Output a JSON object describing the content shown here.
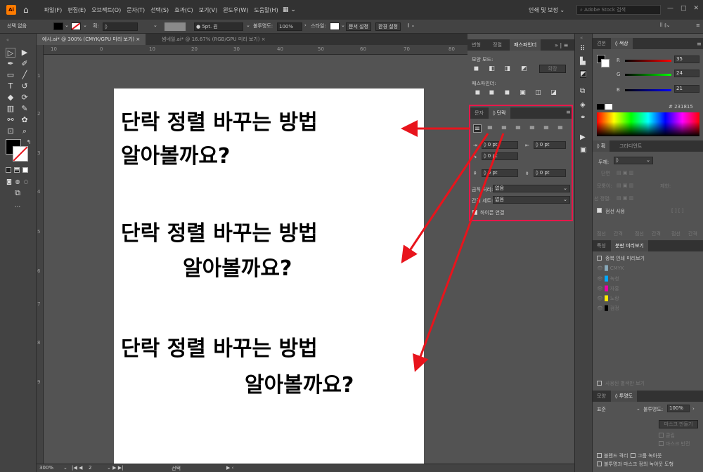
{
  "menubar": {
    "app_logo": "Ai",
    "home_icon": "home-icon",
    "items": [
      "파일(F)",
      "편집(E)",
      "오브젝트(O)",
      "문자(T)",
      "선택(S)",
      "효과(C)",
      "보기(V)",
      "윈도우(W)",
      "도움말(H)"
    ],
    "workspace": "인쇄 및 보정",
    "stock_search_placeholder": "Adobe Stock 검색"
  },
  "control_bar": {
    "selection": "선택 없음",
    "stroke_label": "획:",
    "brush": "5pt. 원",
    "opacity_label": "불투명도:",
    "opacity_value": "100%",
    "style_label": "스타일:",
    "doc_setup": "문서 설정",
    "preferences": "환경 설정"
  },
  "doc_tabs": [
    {
      "label": "예시.ai* @ 300% (CMYK/GPU 미리 보기)",
      "close": "×"
    },
    {
      "label": "썸네일.ai* @ 16.67% (RGB/GPU 미리 보기)",
      "close": "×"
    }
  ],
  "ruler_top": [
    "10",
    "0",
    "10",
    "20",
    "30",
    "40",
    "50",
    "60",
    "70",
    "80"
  ],
  "ruler_left": [
    "1",
    "2",
    "3",
    "4",
    "5",
    "6",
    "7",
    "8",
    "9"
  ],
  "artboard": {
    "block1": {
      "line1": "단락 정렬 바꾸는 방법",
      "line2": "알아볼까요?"
    },
    "block2": {
      "line1": "단락 정렬 바꾸는 방법",
      "line2": "알아볼까요?"
    },
    "block3": {
      "line1": "단락 정렬 바꾸는 방법",
      "line2": "알아볼까요?"
    }
  },
  "status": {
    "zoom": "300%",
    "page": "2",
    "tool": "선택"
  },
  "left_panel": {
    "tabs": [
      "변형",
      "정렬",
      "패스파인더"
    ],
    "shape_modes": "모양 모드:",
    "expand": "확장",
    "pathfinders": "패스파인더:"
  },
  "paragraph_panel": {
    "tabs": [
      "문자",
      "단락"
    ],
    "indent_values": [
      "0 pt",
      "0 pt",
      "0 pt"
    ],
    "space_values": [
      "0 pt",
      "0 pt"
    ],
    "hangul_rule_label": "금칙 처리:",
    "hangul_rule_value": "없음",
    "spacing_label": "간격 세트:",
    "spacing_value": "없음",
    "hyphenate": "하이픈 연결"
  },
  "color_panel": {
    "tabs": [
      "견본",
      "색상"
    ],
    "r": "35",
    "g": "24",
    "b": "21",
    "hex": "231815"
  },
  "stroke_panel": {
    "tabs": [
      "획",
      "그라디언트"
    ],
    "weight_label": "두께:",
    "cap": "단면",
    "corner": "모퉁이:",
    "limit": "제한:",
    "align": "선 정렬:",
    "dashed": "점선 사용",
    "dash_labels": [
      "점선",
      "간격",
      "점선",
      "간격",
      "점선",
      "간격"
    ]
  },
  "attr_panel": {
    "tabs": [
      "특성",
      "분판 미리보기"
    ],
    "overprint": "중복 인쇄 미리보기",
    "plates": [
      "CMYK",
      "녹청",
      "자홍",
      "노랑",
      "검정"
    ],
    "spot_colors": "사용된 별색만 보기"
  },
  "transparency_panel": {
    "tabs": [
      "모양",
      "투명도"
    ],
    "blend": "표준",
    "opacity_label": "불투명도:",
    "opacity_value": "100%",
    "make_mask": "마스크 만들기",
    "clip": "클립",
    "invert": "마스크 반전",
    "isolate": "블렌드 격리",
    "knockout": "그룹 녹아웃",
    "define": "불투명과 마스크 정의 녹아웃 도형"
  },
  "colors": {
    "accent_red": "#e8174a",
    "arrow_red": "#e8141c",
    "panel_bg": "#535353"
  }
}
